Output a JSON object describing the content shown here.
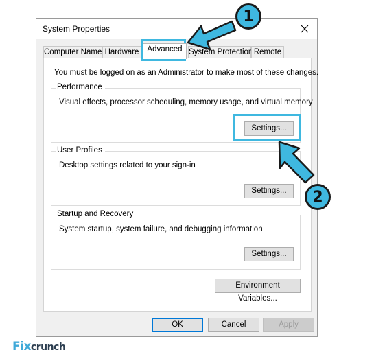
{
  "window": {
    "title": "System Properties",
    "close_glyph": "✕"
  },
  "tabs": [
    {
      "label": "Computer Name",
      "active": false
    },
    {
      "label": "Hardware",
      "active": false
    },
    {
      "label": "Advanced",
      "active": true
    },
    {
      "label": "System Protection",
      "active": false
    },
    {
      "label": "Remote",
      "active": false
    }
  ],
  "advanced": {
    "notice": "You must be logged on as an Administrator to make most of these changes.",
    "performance": {
      "title": "Performance",
      "description": "Visual effects, processor scheduling, memory usage, and virtual memory",
      "button": "Settings..."
    },
    "user_profiles": {
      "title": "User Profiles",
      "description": "Desktop settings related to your sign-in",
      "button": "Settings..."
    },
    "startup_recovery": {
      "title": "Startup and Recovery",
      "description": "System startup, system failure, and debugging information",
      "button": "Settings..."
    },
    "env_button": "Environment Variables..."
  },
  "footer": {
    "ok": "OK",
    "cancel": "Cancel",
    "apply": "Apply"
  },
  "annotations": {
    "badge_1": "1",
    "badge_2": "2",
    "accent_color": "#3fb8e0",
    "focus_color": "#0078d7"
  },
  "watermark": {
    "part1": "Fix",
    "part2": "crunch"
  }
}
